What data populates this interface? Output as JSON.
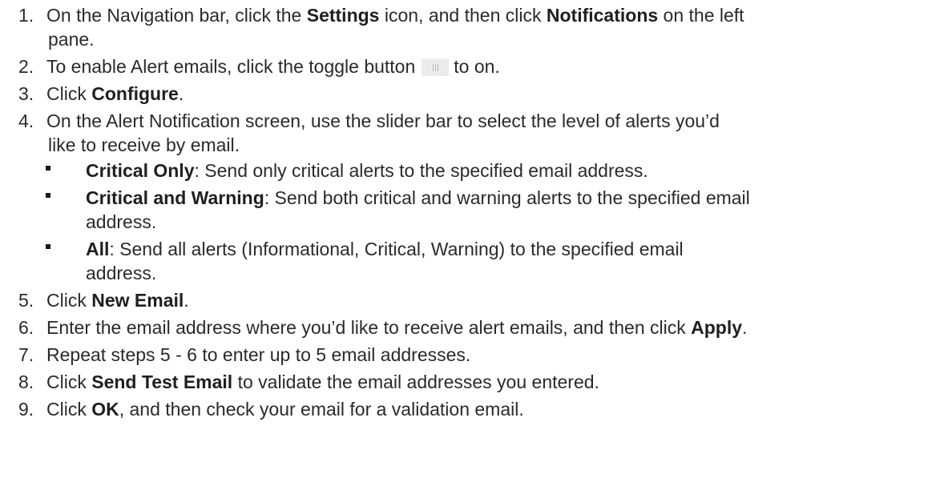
{
  "steps": [
    {
      "num": "1.",
      "parts": [
        "On the Navigation bar, click the ",
        "Settings",
        " icon, and then click ",
        "Notifications",
        " on the left",
        "pane."
      ]
    },
    {
      "num": "2.",
      "parts": [
        "To enable Alert emails, click the toggle button",
        "to on."
      ]
    },
    {
      "num": "3.",
      "parts": [
        "Click ",
        "Configure",
        "."
      ]
    },
    {
      "num": "4.",
      "parts": [
        "On the Alert Notification screen, use the slider bar to select the level of alerts you’d",
        "like to receive by email."
      ],
      "bullets": [
        {
          "term": "Critical Only",
          "lines": [
            ": Send only critical alerts to the specified email address."
          ]
        },
        {
          "term": "Critical and Warning",
          "lines": [
            ": Send both critical and warning alerts to the specified email",
            "address."
          ]
        },
        {
          "term": "All",
          "lines": [
            ": Send all alerts (Informational, Critical, Warning) to the specified email",
            "address."
          ]
        }
      ]
    },
    {
      "num": "5.",
      "parts": [
        "Click ",
        "New Email",
        "."
      ]
    },
    {
      "num": "6.",
      "parts": [
        "Enter the email address where you’d like to receive alert emails, and then click ",
        "Apply",
        "."
      ]
    },
    {
      "num": "7.",
      "parts": [
        "Repeat steps 5 - 6 to enter up to 5 email addresses."
      ]
    },
    {
      "num": "8.",
      "parts": [
        "Click ",
        "Send Test Email",
        " to validate the email addresses you entered."
      ]
    },
    {
      "num": "9.",
      "parts": [
        "Click ",
        "OK",
        ", and then check your email for a validation email."
      ]
    }
  ],
  "icons": {
    "toggle": "toggle-off-icon"
  }
}
